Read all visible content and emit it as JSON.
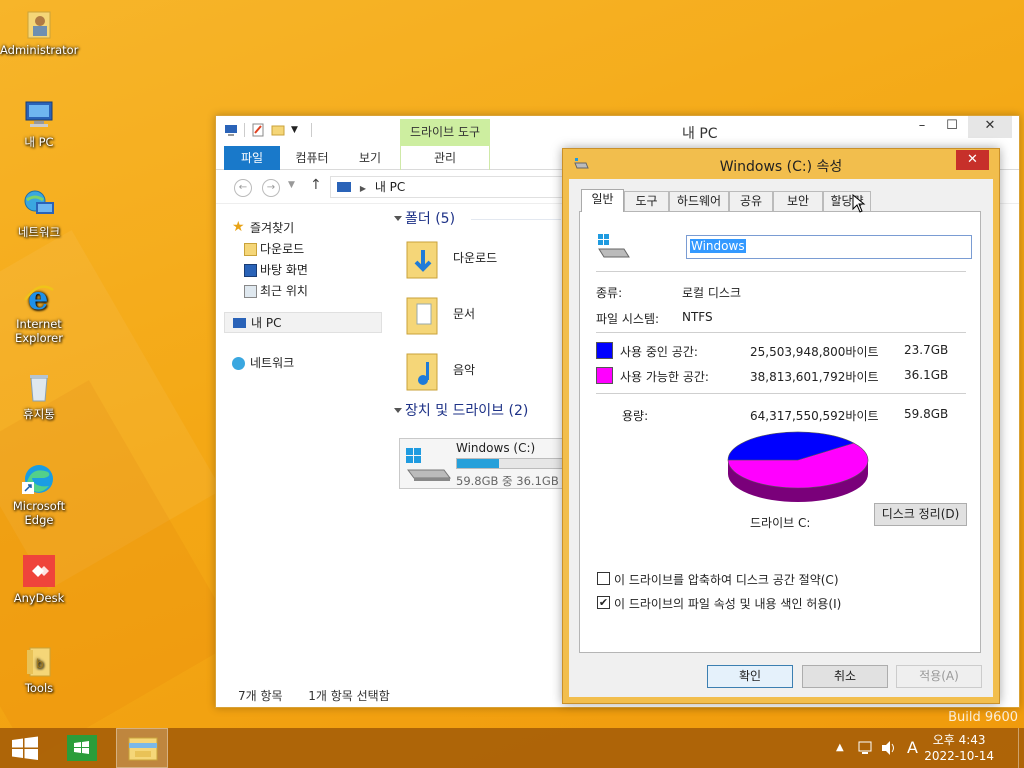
{
  "desktop": {
    "icons": [
      {
        "label": "Administrator",
        "icon": "user-folder-icon"
      },
      {
        "label": "내 PC",
        "icon": "computer-icon"
      },
      {
        "label": "네트워크",
        "icon": "network-icon"
      },
      {
        "label": "Internet Explorer",
        "icon": "ie-icon"
      },
      {
        "label": "휴지통",
        "icon": "recycle-bin-icon"
      },
      {
        "label": "Microsoft Edge",
        "icon": "edge-icon"
      },
      {
        "label": "AnyDesk",
        "icon": "anydesk-icon"
      },
      {
        "label": "Tools",
        "icon": "tools-folder-icon"
      }
    ],
    "watermark": "Build 9600"
  },
  "explorer": {
    "title": "내 PC",
    "context_tab": "드라이브 도구",
    "ribbon_tabs": [
      "파일",
      "컴퓨터",
      "보기",
      "관리"
    ],
    "address": "내 PC",
    "nav": {
      "favorites": "즐겨찾기",
      "fav_items": [
        "다운로드",
        "바탕 화면",
        "최근 위치"
      ],
      "this_pc": "내 PC",
      "network": "네트워크"
    },
    "folders_header": "폴더 (5)",
    "folders": [
      "다운로드",
      "문서",
      "음악"
    ],
    "drives_header": "장치 및 드라이브 (2)",
    "drive": {
      "name": "Windows (C:)",
      "free_text": "59.8GB 중 36.1GB 사",
      "used_fraction": 0.397
    },
    "status": {
      "items": "7개 항목",
      "selected": "1개 항목 선택함"
    }
  },
  "dialog": {
    "title": "Windows (C:) 속성",
    "tabs": [
      "일반",
      "도구",
      "하드웨어",
      "공유",
      "보안",
      "할당량"
    ],
    "volume_name": "Windows",
    "type_label": "종류:",
    "type_value": "로컬 디스크",
    "fs_label": "파일 시스템:",
    "fs_value": "NTFS",
    "used_label": "사용 중인 공간:",
    "used_bytes": "25,503,948,800바이트",
    "used_gb": "23.7GB",
    "free_label": "사용 가능한 공간:",
    "free_bytes": "38,813,601,792바이트",
    "free_gb": "36.1GB",
    "capacity_label": "용량:",
    "capacity_bytes": "64,317,550,592바이트",
    "capacity_gb": "59.8GB",
    "drive_label": "드라이브 C:",
    "cleanup_button": "디스크 정리(D)",
    "compress_label": "이 드라이브를 압축하여 디스크 공간 절약(C)",
    "compress_checked": false,
    "index_label": "이 드라이브의 파일 속성 및 내용 색인 허용(I)",
    "index_checked": true,
    "ok": "확인",
    "cancel": "취소",
    "apply": "적용(A)",
    "colors": {
      "used": "#0000ff",
      "free": "#ff00ff"
    }
  },
  "taskbar": {
    "ime": "A",
    "time": "오후 4:43",
    "date": "2022-10-14"
  }
}
